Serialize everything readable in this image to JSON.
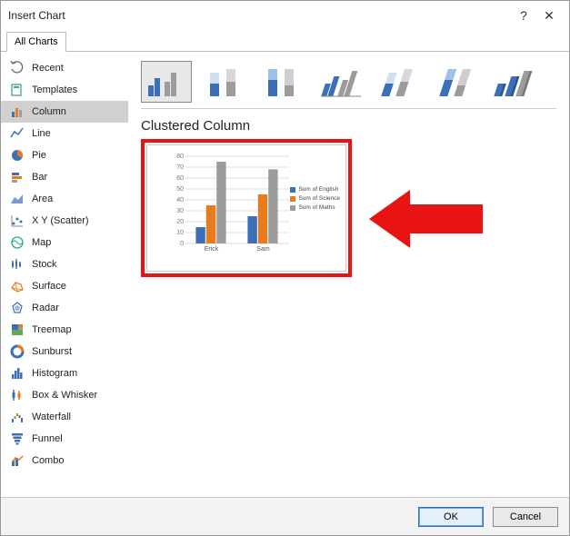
{
  "window": {
    "title": "Insert Chart"
  },
  "tabs": {
    "all_charts": "All Charts"
  },
  "sidebar": {
    "items": [
      {
        "label": "Recent"
      },
      {
        "label": "Templates"
      },
      {
        "label": "Column"
      },
      {
        "label": "Line"
      },
      {
        "label": "Pie"
      },
      {
        "label": "Bar"
      },
      {
        "label": "Area"
      },
      {
        "label": "X Y (Scatter)"
      },
      {
        "label": "Map"
      },
      {
        "label": "Stock"
      },
      {
        "label": "Surface"
      },
      {
        "label": "Radar"
      },
      {
        "label": "Treemap"
      },
      {
        "label": "Sunburst"
      },
      {
        "label": "Histogram"
      },
      {
        "label": "Box & Whisker"
      },
      {
        "label": "Waterfall"
      },
      {
        "label": "Funnel"
      },
      {
        "label": "Combo"
      }
    ],
    "selected_index": 2
  },
  "subtypes": {
    "title": "Clustered Column",
    "selected_index": 0
  },
  "chart_data": {
    "type": "bar",
    "categories": [
      "Erick",
      "Sam"
    ],
    "series": [
      {
        "name": "Sum of English",
        "color": "#3b6fb6",
        "values": [
          15,
          25
        ]
      },
      {
        "name": "Sum of Science",
        "color": "#e87b1e",
        "values": [
          35,
          45
        ]
      },
      {
        "name": "Sum of Maths",
        "color": "#9c9c9c",
        "values": [
          75,
          68
        ]
      }
    ],
    "ylim": [
      0,
      80
    ],
    "ytick": 10,
    "title": "",
    "xlabel": "",
    "ylabel": ""
  },
  "footer": {
    "ok": "OK",
    "cancel": "Cancel"
  },
  "colors": {
    "highlight_border": "#e81313",
    "arrow": "#e81313"
  }
}
